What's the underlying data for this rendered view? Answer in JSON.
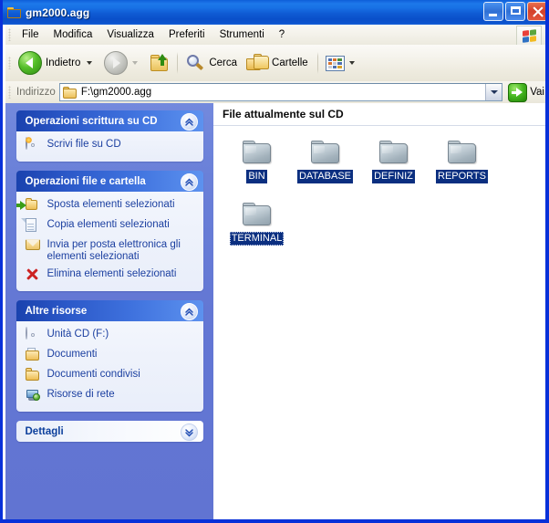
{
  "window": {
    "title": "gm2000.agg",
    "title_icon": "folder-icon",
    "buttons": {
      "minimize": "minimize-button",
      "maximize": "maximize-button",
      "close": "close-button"
    }
  },
  "menubar": {
    "items": [
      {
        "label": "File"
      },
      {
        "label": "Modifica"
      },
      {
        "label": "Visualizza"
      },
      {
        "label": "Preferiti"
      },
      {
        "label": "Strumenti"
      },
      {
        "label": "?"
      }
    ],
    "brand_icon": "windows-flag-icon"
  },
  "toolbar": {
    "back_label": "Indietro",
    "forward_label": "",
    "up_icon": "up-folder-icon",
    "search_label": "Cerca",
    "folders_label": "Cartelle",
    "views_icon": "views-icon"
  },
  "address": {
    "label": "Indirizzo",
    "value": "F:\\gm2000.agg",
    "icon": "folder-icon",
    "go_label": "Vai"
  },
  "sidebar": {
    "panels": [
      {
        "title": "Operazioni scrittura su CD",
        "style": "blue",
        "collapse_icon": "chevron-up-icon",
        "items": [
          {
            "label": "Scrivi file su CD",
            "icon": "cd-burn-icon"
          }
        ]
      },
      {
        "title": "Operazioni file e cartella",
        "style": "blue",
        "collapse_icon": "chevron-up-icon",
        "items": [
          {
            "label": "Sposta elementi selezionati",
            "icon": "move-folder-icon"
          },
          {
            "label": "Copia elementi selezionati",
            "icon": "copy-document-icon"
          },
          {
            "label": "Invia per posta elettronica gli elementi selezionati",
            "icon": "mail-icon"
          },
          {
            "label": "Elimina elementi selezionati",
            "icon": "delete-x-icon"
          }
        ]
      },
      {
        "title": "Altre risorse",
        "style": "blue",
        "collapse_icon": "chevron-up-icon",
        "items": [
          {
            "label": "Unità CD (F:)",
            "icon": "cd-drive-icon"
          },
          {
            "label": "Documenti",
            "icon": "my-documents-icon"
          },
          {
            "label": "Documenti condivisi",
            "icon": "shared-documents-icon"
          },
          {
            "label": "Risorse di rete",
            "icon": "network-icon"
          }
        ]
      },
      {
        "title": "Dettagli",
        "style": "light",
        "collapse_icon": "chevron-down-icon",
        "items": []
      }
    ]
  },
  "main": {
    "group_header": "File attualmente sul CD",
    "files": [
      {
        "name": "BIN",
        "icon": "pending-folder-icon",
        "focused": false
      },
      {
        "name": "DATABASE",
        "icon": "pending-folder-icon",
        "focused": false
      },
      {
        "name": "DEFINIZ",
        "icon": "pending-folder-icon",
        "focused": false
      },
      {
        "name": "REPORTS",
        "icon": "pending-folder-icon",
        "focused": false
      },
      {
        "name": "TERMINAL",
        "icon": "pending-folder-icon",
        "focused": true
      }
    ]
  },
  "colors": {
    "window_border": "#0831d9",
    "title_bar": "#0a4fc9",
    "sidebar_bg": "#6377d4",
    "panel_header": "#2c59c9",
    "link_text": "#1b3fa0",
    "label_selected_bg": "#0b2f80",
    "close_button": "#d3412a"
  }
}
